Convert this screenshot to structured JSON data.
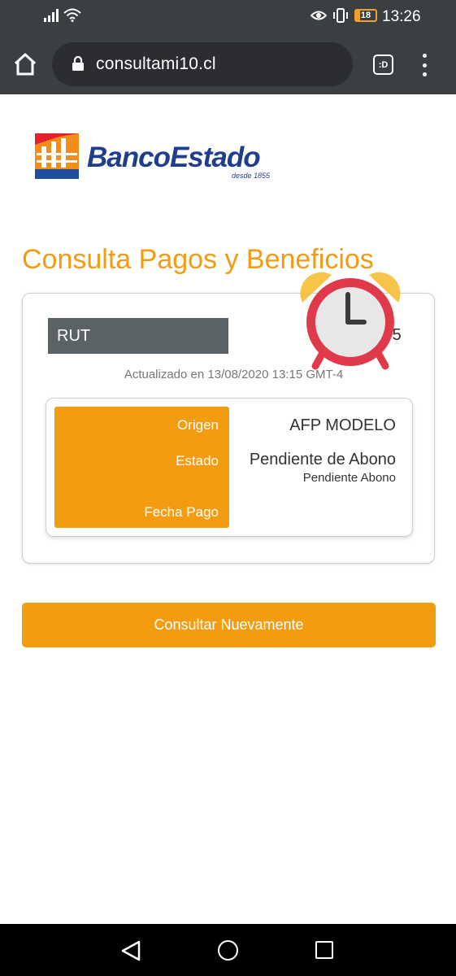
{
  "status_bar": {
    "time": "13:26",
    "battery_level": "18",
    "icons": [
      "signal-icon",
      "wifi-icon",
      "eye-icon",
      "vibrate-icon",
      "battery-icon"
    ]
  },
  "browser": {
    "url": "consultami10.cl",
    "tabs_label": ":D",
    "icons": [
      "home-icon",
      "lock-icon",
      "tabs-icon",
      "menu-icon"
    ]
  },
  "logo": {
    "name": "BancoEstado",
    "tagline": "desde 1855",
    "colors": {
      "red": "#e3242b",
      "orange": "#f28c1b",
      "blue": "#1f4e9c",
      "text": "#1f3e8c"
    }
  },
  "page": {
    "title": "Consulta Pagos y Beneficios"
  },
  "result": {
    "rut_label": "RUT",
    "rut_value_visible": "-5",
    "updated_text": "Actualizado en 13/08/2020 13:15 GMT-4",
    "fields": {
      "origen_label": "Origen",
      "origen_value": "AFP MODELO",
      "estado_label": "Estado",
      "estado_value": "Pendiente de Abono",
      "estado_sub": "Pendiente Abono",
      "fecha_label": "Fecha Pago",
      "fecha_value": ""
    }
  },
  "actions": {
    "consultar_label": "Consultar Nuevamente"
  },
  "overlay": {
    "icon": "alarm-clock-icon",
    "colors": {
      "bells": "#f7c44a",
      "body": "#e0394a",
      "face": "#e7e7e7",
      "hands": "#3a3a3a"
    }
  },
  "theme": {
    "accent": "#f39c12",
    "rut_bg": "#5a6265",
    "chrome_bg": "#3c3f42"
  },
  "nav": {
    "icons": [
      "back-icon",
      "home-circle-icon",
      "recents-icon"
    ]
  }
}
